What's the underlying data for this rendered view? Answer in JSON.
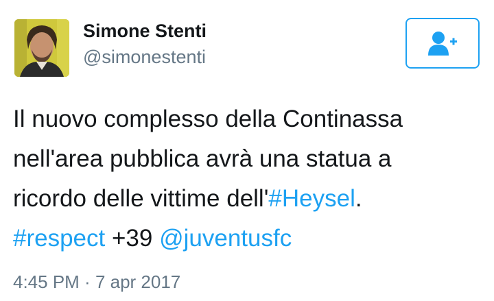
{
  "author": {
    "name": "Simone Stenti",
    "handle": "@simonestenti"
  },
  "follow_button": {
    "icon": "add-user-icon"
  },
  "tweet": {
    "line1": "Il nuovo complesso della Continassa",
    "line2": "nell'area pubblica avrà una statua a",
    "line3_text": "ricordo delle vittime dell'",
    "hashtag_heysel": "#Heysel",
    "line3_end": ".",
    "hashtag_respect": "#respect",
    "plain_39": " +39 ",
    "mention_juventus": "@juventusfc"
  },
  "meta": {
    "time": "4:45 PM",
    "separator": " · ",
    "date": "7 apr 2017"
  },
  "colors": {
    "accent": "#1da1f2",
    "text": "#14171a",
    "secondary": "#657786"
  }
}
